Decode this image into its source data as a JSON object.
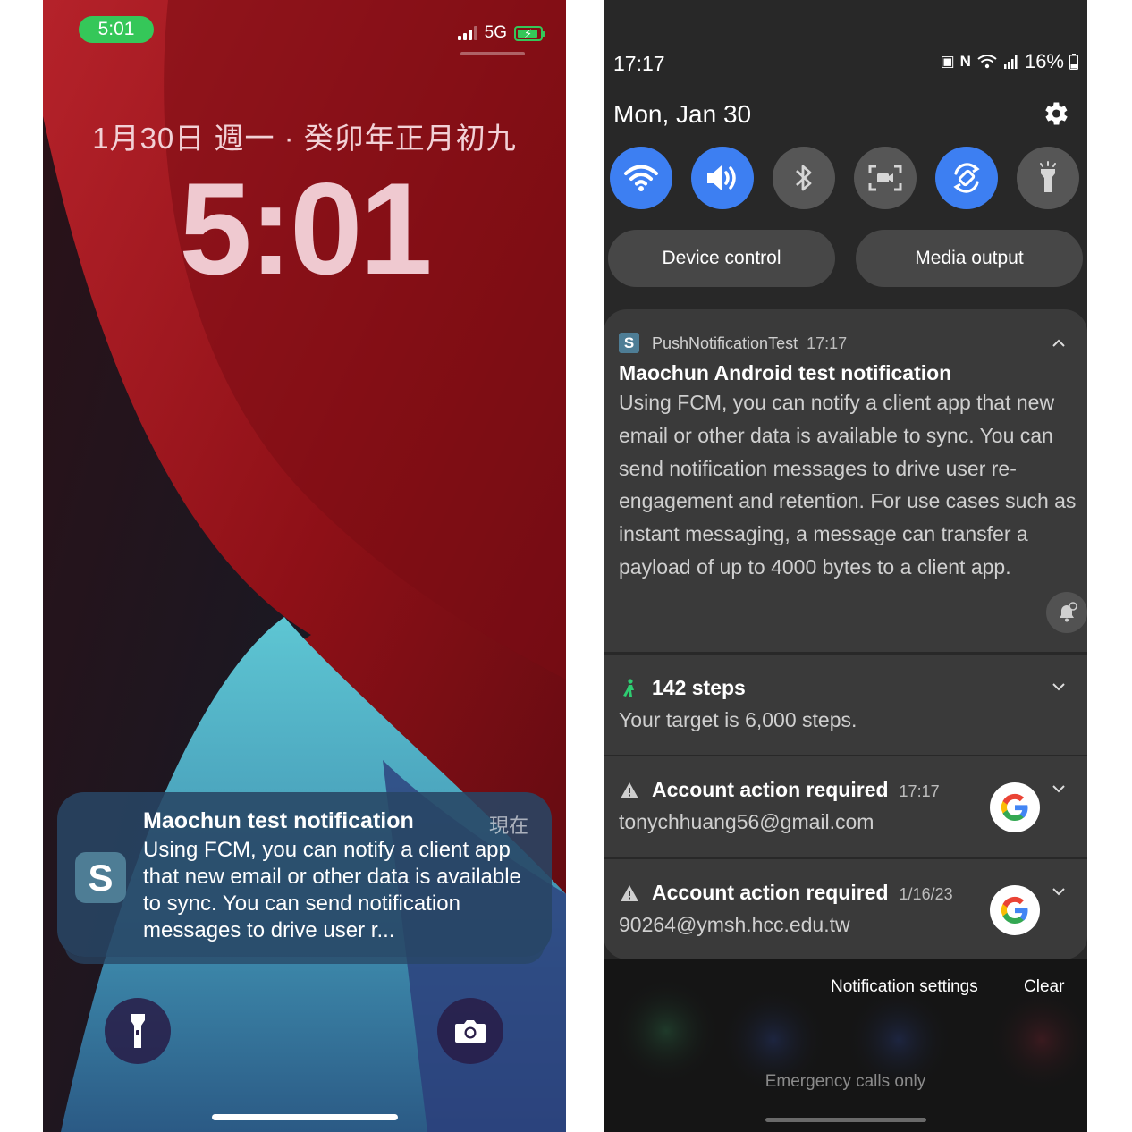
{
  "ios": {
    "status_time": "5:01",
    "network": "5G",
    "date_line": "1月30日 週一 · 癸卯年正月初九",
    "clock": "5:01",
    "notification": {
      "app_icon_letter": "S",
      "title": "Maochun test notification",
      "time": "現在",
      "body": "Using FCM, you can notify a client app that new email or other data is available to sync. You can send notification messages to drive user r..."
    },
    "buttons": {
      "left_icon": "flashlight-icon",
      "right_icon": "camera-icon"
    }
  },
  "android": {
    "status_time": "17:17",
    "battery": "16%",
    "date": "Mon, Jan 30",
    "quick_settings": [
      {
        "icon": "wifi-icon",
        "state": "on"
      },
      {
        "icon": "volume-icon",
        "state": "on"
      },
      {
        "icon": "bluetooth-icon",
        "state": "off"
      },
      {
        "icon": "screen-recorder-icon",
        "state": "off"
      },
      {
        "icon": "auto-rotate-icon",
        "state": "on"
      },
      {
        "icon": "flashlight-icon",
        "state": "off"
      }
    ],
    "device_control": "Device control",
    "media_output": "Media output",
    "push_notification": {
      "app_letter": "S",
      "app_name": "PushNotificationTest",
      "time": "17:17",
      "title": "Maochun Android test notification",
      "body": "Using FCM, you can notify a client app that new email or other data is available to sync. You can send notification messages to drive user re-engagement and retention. For use cases such as instant messaging, a message can transfer a payload of up to 4000 bytes to a client app."
    },
    "steps_notification": {
      "title": "142 steps",
      "subtitle": "Your target is 6,000 steps."
    },
    "account_notifications": [
      {
        "title": "Account action required",
        "time": "17:17",
        "email": "tonychhuang56@gmail.com"
      },
      {
        "title": "Account action required",
        "time": "1/16/23",
        "email": "90264@ymsh.hcc.edu.tw"
      }
    ],
    "notification_settings": "Notification settings",
    "clear": "Clear",
    "emergency": "Emergency calls only",
    "colors": {
      "accent": "#3d7ff2",
      "panel": "#3a3a3a",
      "background": "#282828"
    }
  }
}
